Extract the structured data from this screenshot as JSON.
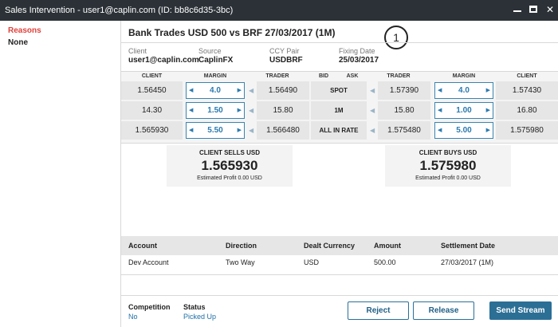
{
  "window": {
    "title": "Sales Intervention - user1@caplin.com (ID: bb8c6d35-3bc)"
  },
  "sidebar": {
    "reasons_label": "Reasons",
    "reasons_value": "None"
  },
  "header": {
    "title": "Bank Trades USD 500 vs BRF 27/03/2017 (1M)",
    "badge": "1"
  },
  "info": {
    "client_label": "Client",
    "client_value": "user1@caplin.com",
    "source_label": "Source",
    "source_value": "CaplinFX",
    "pair_label": "CCY Pair",
    "pair_value": "USDBRF",
    "fixing_label": "Fixing Date",
    "fixing_value": "25/03/2017"
  },
  "grid": {
    "headers": {
      "client_left": "CLIENT",
      "margin_left": "MARGIN",
      "trader_left": "TRADER",
      "bid": "BID",
      "ask": "ASK",
      "trader_right": "TRADER",
      "margin_right": "MARGIN",
      "client_right": "CLIENT"
    },
    "rows": [
      {
        "label": "SPOT",
        "client_bid": "1.56450",
        "margin_bid": "4.0",
        "trader_bid": "1.56490",
        "trader_ask": "1.57390",
        "margin_ask": "4.0",
        "client_ask": "1.57430"
      },
      {
        "label": "1M",
        "client_bid": "14.30",
        "margin_bid": "1.50",
        "trader_bid": "15.80",
        "trader_ask": "15.80",
        "margin_ask": "1.00",
        "client_ask": "16.80"
      },
      {
        "label": "ALL IN RATE",
        "client_bid": "1.565930",
        "margin_bid": "5.50",
        "trader_bid": "1.566480",
        "trader_ask": "1.575480",
        "margin_ask": "5.00",
        "client_ask": "1.575980"
      }
    ]
  },
  "sells": {
    "heading": "CLIENT SELLS USD",
    "price": "1.565930",
    "profit": "Estimated Profit 0.00 USD"
  },
  "buys": {
    "heading": "CLIENT BUYS USD",
    "price": "1.575980",
    "profit": "Estimated Profit 0.00 USD"
  },
  "deal_table": {
    "headers": {
      "account": "Account",
      "direction": "Direction",
      "currency": "Dealt Currency",
      "amount": "Amount",
      "settlement": "Settlement Date"
    },
    "row": {
      "account": "Dev Account",
      "direction": "Two Way",
      "currency": "USD",
      "amount": "500.00",
      "settlement": "27/03/2017 (1M)"
    }
  },
  "footer": {
    "competition_label": "Competition",
    "competition_value": "No",
    "status_label": "Status",
    "status_value": "Picked Up",
    "reject_label": "Reject",
    "release_label": "Release",
    "send_label": "Send Stream"
  }
}
